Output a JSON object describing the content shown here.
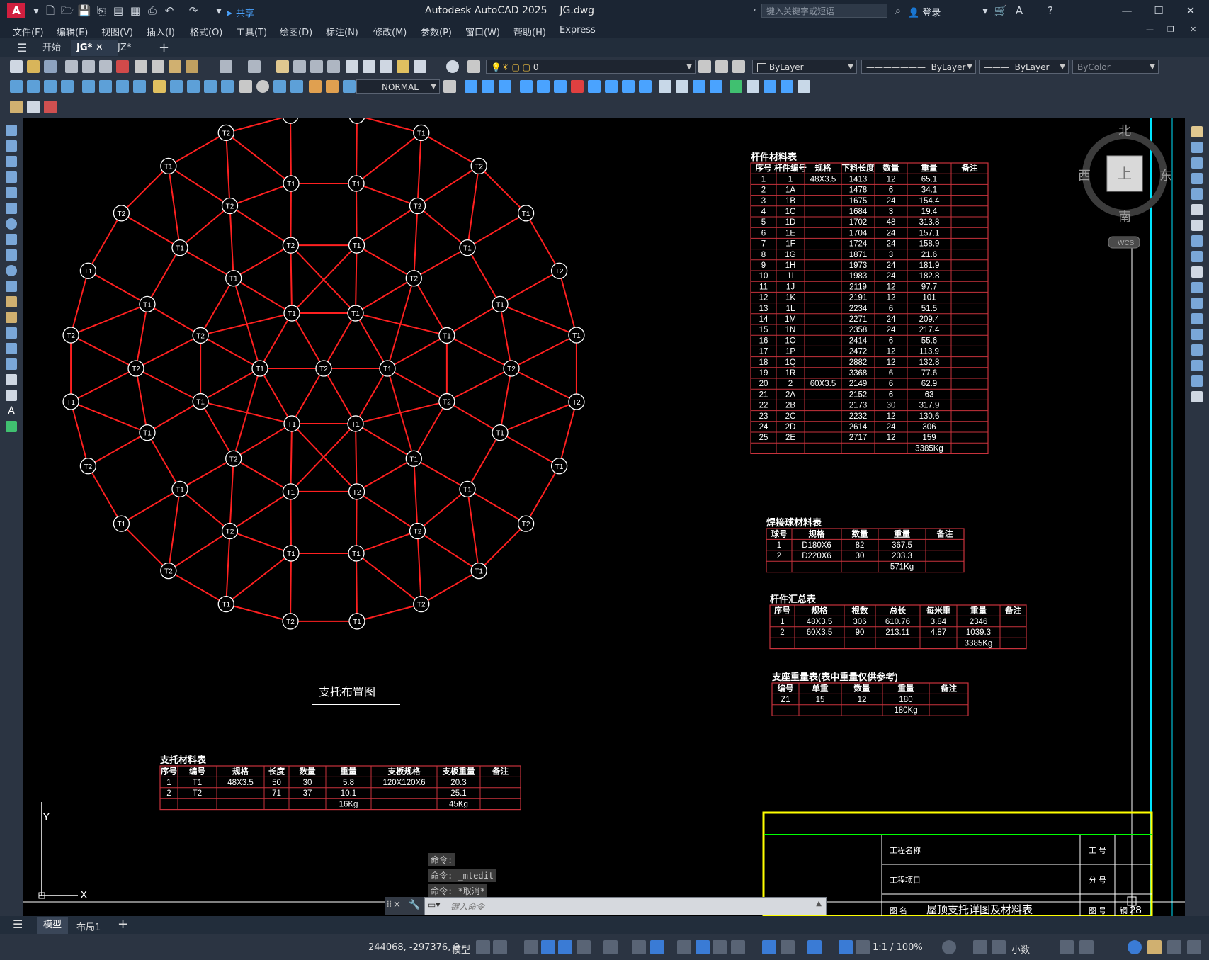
{
  "app": {
    "title": "Autodesk AutoCAD 2025",
    "filename": "JG.dwg",
    "share_label": "共享",
    "search_placeholder": "键入关键字或短语",
    "login_label": "登录"
  },
  "menu": [
    "文件(F)",
    "编辑(E)",
    "视图(V)",
    "插入(I)",
    "格式(O)",
    "工具(T)",
    "绘图(D)",
    "标注(N)",
    "修改(M)",
    "参数(P)",
    "窗口(W)",
    "帮助(H)",
    "Express"
  ],
  "tabs": [
    "开始",
    "JG*",
    "JZ*"
  ],
  "layer_combo": "0",
  "color_combo": "ByLayer",
  "linetype_combo": "ByLayer",
  "lineweight_combo": "ByLayer",
  "plotstyle_combo": "ByColor",
  "dimstyle_combo": "NORMAL",
  "viewcube": {
    "north": "北",
    "south": "南",
    "east": "东",
    "west": "西",
    "top": "上",
    "wcs": "WCS"
  },
  "colors": {
    "structure": "#ff2020",
    "table_border": "#c8323c",
    "frame_yellow": "#ffff00",
    "frame_green": "#00ff00",
    "cyan": "#00ffff"
  },
  "plan_title": "支托布置图",
  "rod_table": {
    "title": "杆件材料表",
    "headers": [
      "序号",
      "杆件编号",
      "规格",
      "下料长度",
      "数量",
      "重量",
      "备注"
    ],
    "rows": [
      [
        "1",
        "1",
        "48X3.5",
        "1413",
        "12",
        "65.1",
        ""
      ],
      [
        "2",
        "1A",
        "",
        "1478",
        "6",
        "34.1",
        ""
      ],
      [
        "3",
        "1B",
        "",
        "1675",
        "24",
        "154.4",
        ""
      ],
      [
        "4",
        "1C",
        "",
        "1684",
        "3",
        "19.4",
        ""
      ],
      [
        "5",
        "1D",
        "",
        "1702",
        "48",
        "313.8",
        ""
      ],
      [
        "6",
        "1E",
        "",
        "1704",
        "24",
        "157.1",
        ""
      ],
      [
        "7",
        "1F",
        "",
        "1724",
        "24",
        "158.9",
        ""
      ],
      [
        "8",
        "1G",
        "",
        "1871",
        "3",
        "21.6",
        ""
      ],
      [
        "9",
        "1H",
        "",
        "1973",
        "24",
        "181.9",
        ""
      ],
      [
        "10",
        "1I",
        "",
        "1983",
        "24",
        "182.8",
        ""
      ],
      [
        "11",
        "1J",
        "",
        "2119",
        "12",
        "97.7",
        ""
      ],
      [
        "12",
        "1K",
        "",
        "2191",
        "12",
        "101",
        ""
      ],
      [
        "13",
        "1L",
        "",
        "2234",
        "6",
        "51.5",
        ""
      ],
      [
        "14",
        "1M",
        "",
        "2271",
        "24",
        "209.4",
        ""
      ],
      [
        "15",
        "1N",
        "",
        "2358",
        "24",
        "217.4",
        ""
      ],
      [
        "16",
        "1O",
        "",
        "2414",
        "6",
        "55.6",
        ""
      ],
      [
        "17",
        "1P",
        "",
        "2472",
        "12",
        "113.9",
        ""
      ],
      [
        "18",
        "1Q",
        "",
        "2882",
        "12",
        "132.8",
        ""
      ],
      [
        "19",
        "1R",
        "",
        "3368",
        "6",
        "77.6",
        ""
      ],
      [
        "20",
        "2",
        "60X3.5",
        "2149",
        "6",
        "62.9",
        ""
      ],
      [
        "21",
        "2A",
        "",
        "2152",
        "6",
        "63",
        ""
      ],
      [
        "22",
        "2B",
        "",
        "2173",
        "30",
        "317.9",
        ""
      ],
      [
        "23",
        "2C",
        "",
        "2232",
        "12",
        "130.6",
        ""
      ],
      [
        "24",
        "2D",
        "",
        "2614",
        "24",
        "306",
        ""
      ],
      [
        "25",
        "2E",
        "",
        "2717",
        "12",
        "159",
        ""
      ]
    ],
    "total": "3385Kg"
  },
  "ball_table": {
    "title": "焊接球材料表",
    "headers": [
      "球号",
      "规格",
      "数量",
      "重量",
      "备注"
    ],
    "rows": [
      [
        "1",
        "D180X6",
        "82",
        "367.5",
        ""
      ],
      [
        "2",
        "D220X6",
        "30",
        "203.3",
        ""
      ]
    ],
    "total": "571Kg"
  },
  "summary_table": {
    "title": "杆件汇总表",
    "headers": [
      "序号",
      "规格",
      "根数",
      "总长",
      "每米重",
      "重量",
      "备注"
    ],
    "rows": [
      [
        "1",
        "48X3.5",
        "306",
        "610.76",
        "3.84",
        "2346",
        ""
      ],
      [
        "2",
        "60X3.5",
        "90",
        "213.11",
        "4.87",
        "1039.3",
        ""
      ]
    ],
    "total": "3385Kg"
  },
  "support_table": {
    "title": "支座重量表(表中重量仅供参考)",
    "headers": [
      "编号",
      "单重",
      "数量",
      "重量",
      "备注"
    ],
    "rows": [
      [
        "Z1",
        "15",
        "12",
        "180",
        ""
      ]
    ],
    "total": "180Kg"
  },
  "bracket_table": {
    "title": "支托材料表",
    "headers": [
      "序号",
      "编号",
      "规格",
      "长度",
      "数量",
      "重量",
      "支板规格",
      "支板重量",
      "备注"
    ],
    "rows": [
      [
        "1",
        "T1",
        "48X3.5",
        "50",
        "30",
        "5.8",
        "120X120X6",
        "20.3",
        ""
      ],
      [
        "2",
        "T2",
        "",
        "71",
        "37",
        "10.1",
        "",
        "25.1",
        ""
      ]
    ],
    "total_weight": "16Kg",
    "total_plate": "45Kg"
  },
  "title_block": {
    "project_name_label": "工程名称",
    "project_item_label": "工程项目",
    "drawing_name_label": "图 名",
    "drawing_name": "屋顶支托详图及材料表",
    "job_no_label": "工 号",
    "sub_no_label": "分 号",
    "drawing_no_label": "图 号",
    "drawing_no_prefix": "钢",
    "drawing_no": "28"
  },
  "ucs": {
    "x": "X",
    "y": "Y"
  },
  "command_history": [
    "命令:",
    "命令: _mtedit",
    "命令: *取消*"
  ],
  "command_placeholder": "键入命令",
  "layout_tabs": [
    "模型",
    "布局1"
  ],
  "status": {
    "coords": "244068, -297376, 0",
    "model": "模型",
    "scale": "1:1 / 100%",
    "units": "小数"
  }
}
